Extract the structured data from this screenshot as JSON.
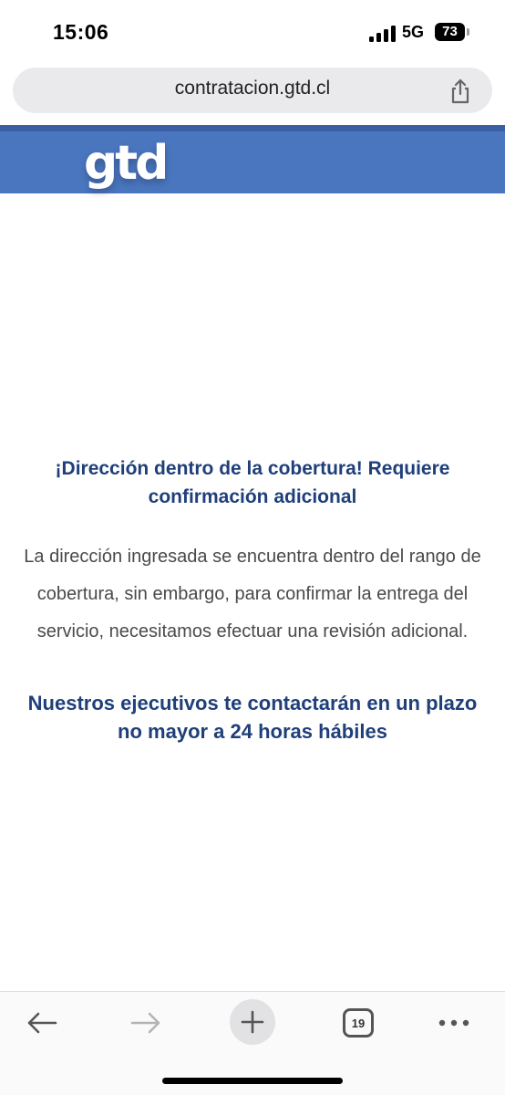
{
  "status_bar": {
    "time": "15:06",
    "network": "5G",
    "battery": "73"
  },
  "browser": {
    "url": "contratacion.gtd.cl",
    "tabs_count": "19"
  },
  "brand": {
    "logo_text": "gtd",
    "header_color": "#4a76c0"
  },
  "content": {
    "title": "¡Dirección dentro de la cobertura! Requiere confirmación adicional",
    "description": "La dirección ingresada se encuentra dentro del rango de cobertura, sin embargo, para confirmar la entrega del servicio, necesitamos efectuar una revisión adicional.",
    "notice": "Nuestros ejecutivos te contactarán en un plazo no mayor a 24 horas hábiles",
    "accent_color": "#1f3f7a"
  },
  "toolbar": {
    "icons": [
      "back-arrow-icon",
      "forward-arrow-icon",
      "plus-icon",
      "tabs-icon",
      "more-icon"
    ]
  }
}
